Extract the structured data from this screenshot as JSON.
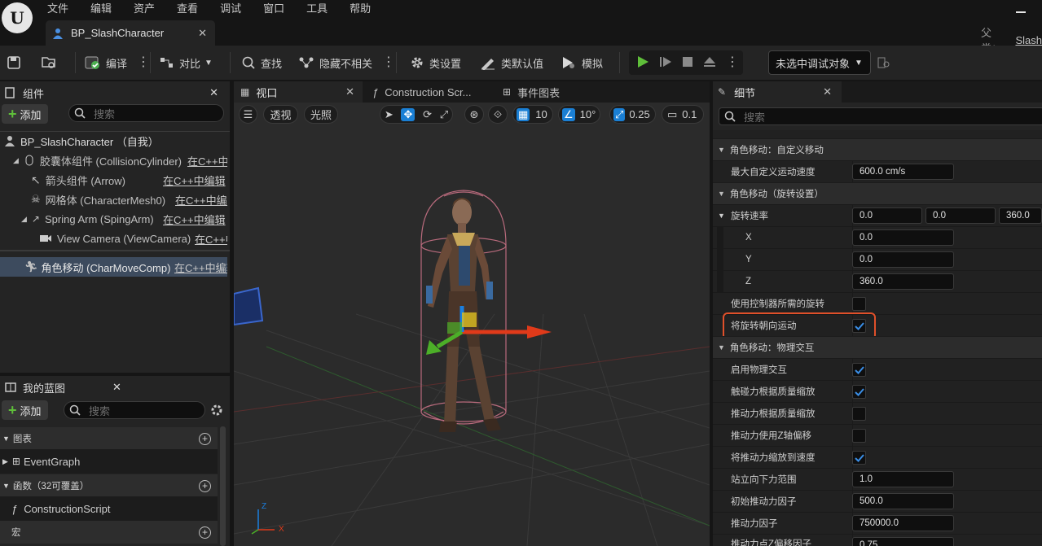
{
  "menu": [
    "文件",
    "编辑",
    "资产",
    "查看",
    "调试",
    "窗口",
    "工具",
    "帮助"
  ],
  "document_tab": {
    "label": "BP_SlashCharacter"
  },
  "parent_class": {
    "label": "父类：",
    "value": "Slash"
  },
  "toolbar": {
    "compile": "编译",
    "diff": "对比",
    "find": "查找",
    "hide_unrelated": "隐藏不相关",
    "class_settings": "类设置",
    "class_defaults": "类默认值",
    "simulate": "模拟",
    "debug_object": "未选中调试对象"
  },
  "components_panel": {
    "title": "组件",
    "add": "添加",
    "search_placeholder": "搜索",
    "items": [
      {
        "label": "BP_SlashCharacter （自我）",
        "cpp": ""
      },
      {
        "label": "胶囊体组件 (CollisionCylinder)",
        "cpp": "在C++中"
      },
      {
        "label": "箭头组件 (Arrow)",
        "cpp": "在C++中编辑"
      },
      {
        "label": "网格体 (CharacterMesh0)",
        "cpp": "在C++中编辑"
      },
      {
        "label": "Spring Arm (SpingArm)",
        "cpp": "在C++中编辑"
      },
      {
        "label": "View Camera (ViewCamera)",
        "cpp": "在C++中"
      },
      {
        "label": "角色移动 (CharMoveComp)",
        "cpp": "在C++中编辑"
      }
    ]
  },
  "blueprint_panel": {
    "title": "我的蓝图",
    "add": "添加",
    "search_placeholder": "搜索",
    "sections": {
      "graphs": "图表",
      "functions": "函数（32可覆盖）",
      "macros": "宏"
    },
    "items": {
      "event_graph": "EventGraph",
      "construction_script": "ConstructionScript"
    }
  },
  "editor_tabs": {
    "viewport": "视口",
    "construction": "Construction Scr...",
    "event_graph": "事件图表"
  },
  "viewport_toolbar": {
    "perspective": "透视",
    "lit": "光照",
    "grid_snap": "10",
    "rot_snap": "10°",
    "scale_snap": "0.25",
    "camera_speed": "0.1"
  },
  "details_panel": {
    "title": "细节",
    "search_placeholder": "搜索",
    "sec_custom": "角色移动：自定义移动",
    "max_custom_speed": {
      "label": "最大自定义运动速度",
      "value": "600.0 cm/s"
    },
    "sec_rotation": "角色移动（旋转设置）",
    "rotation_rate": {
      "label": "旋转速率",
      "x": "0.0",
      "y": "0.0",
      "z": "360.0"
    },
    "axis": {
      "x": "X",
      "y": "Y",
      "z": "Z"
    },
    "use_controller_rot": {
      "label": "使用控制器所需的旋转",
      "checked": false
    },
    "orient_to_movement": {
      "label": "将旋转朝向运动",
      "checked": true
    },
    "sec_physics": "角色移动：物理交互",
    "enable_physics": {
      "label": "启用物理交互",
      "checked": true
    },
    "touch_force_mass": {
      "label": "触碰力根据质量缩放",
      "checked": true
    },
    "push_force_mass": {
      "label": "推动力根据质量缩放",
      "checked": false
    },
    "push_force_z": {
      "label": "推动力使用Z轴偏移",
      "checked": false
    },
    "scale_push_velocity": {
      "label": "将推动力缩放到速度",
      "checked": true
    },
    "standing_down_force": {
      "label": "站立向下力范围",
      "value": "1.0"
    },
    "initial_push_factor": {
      "label": "初始推动力因子",
      "value": "500.0"
    },
    "push_factor": {
      "label": "推动力因子",
      "value": "750000.0"
    },
    "push_point_z": {
      "label": "推动力点Z偏移因子",
      "value": "0.75"
    }
  },
  "colors": {
    "accent": "#1a7fd4",
    "highlight_box": "#e0502a",
    "play": "#5fbf3a"
  },
  "gizmo_axes": {
    "x": "X",
    "y": "Y",
    "z": "Z"
  }
}
